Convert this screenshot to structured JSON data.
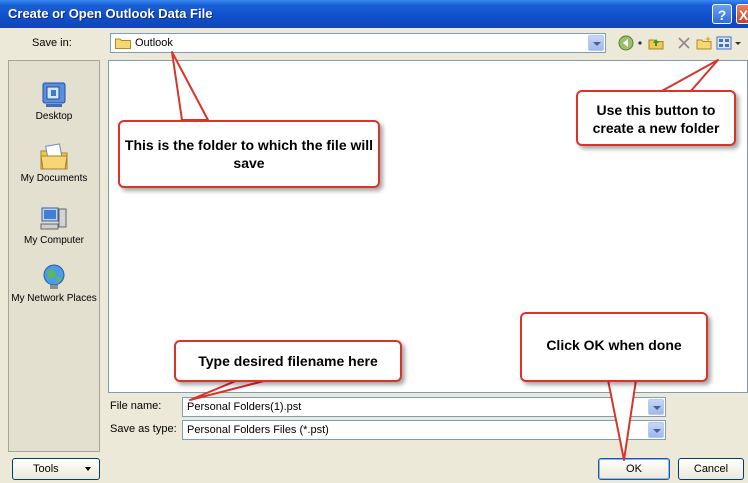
{
  "window": {
    "title": "Create or Open Outlook Data File",
    "help_glyph": "?",
    "close_glyph": "X"
  },
  "save_in": {
    "label": "Save in:",
    "value": "Outlook"
  },
  "toolbar_icons": [
    "back-icon",
    "up-folder-icon",
    "delete-icon",
    "new-folder-icon",
    "views-icon"
  ],
  "places": [
    {
      "label": "Desktop",
      "icon": "desktop-icon"
    },
    {
      "label": "My Documents",
      "icon": "my-documents-icon"
    },
    {
      "label": "My Computer",
      "icon": "my-computer-icon"
    },
    {
      "label": "My Network Places",
      "icon": "network-places-icon"
    }
  ],
  "file_name": {
    "label": "File name:",
    "value": "Personal Folders(1).pst"
  },
  "save_as_type": {
    "label": "Save as type:",
    "value": "Personal Folders Files (*.pst)"
  },
  "buttons": {
    "tools": "Tools",
    "ok": "OK",
    "cancel": "Cancel"
  },
  "callouts": {
    "folder": "This is the folder to which the file will save",
    "new_folder": "Use this button to create a new folder",
    "filename": "Type desired filename here",
    "ok": "Click OK when done"
  },
  "colors": {
    "titlebar": "#0f4fca",
    "dialog_bg": "#ece9d8",
    "callout_border": "#d9342c"
  }
}
